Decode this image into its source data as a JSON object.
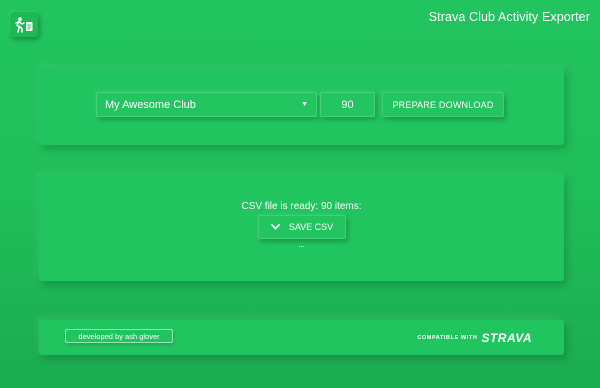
{
  "header": {
    "app_icon": "runner-with-document-icon",
    "title": "Strava Club Activity Exporter"
  },
  "controls": {
    "club_select": {
      "value": "My Awesome Club",
      "caret_icon": "caret-down-icon"
    },
    "count_input": {
      "value": "90"
    },
    "prepare_button": {
      "label": "PREPARE DOWNLOAD"
    }
  },
  "result": {
    "status_text": "CSV file is ready: 90 items:",
    "save_button": {
      "label": "SAVE CSV",
      "icon": "chevron-down-icon"
    },
    "dots": "..."
  },
  "footer": {
    "credit_label": "developed by ash glover",
    "compatible_label": "COMPATIBLE WITH",
    "brand": "STRAVA"
  },
  "colors": {
    "background": "#1fbd59",
    "panel": "#21c55f",
    "text": "#ffffff"
  }
}
